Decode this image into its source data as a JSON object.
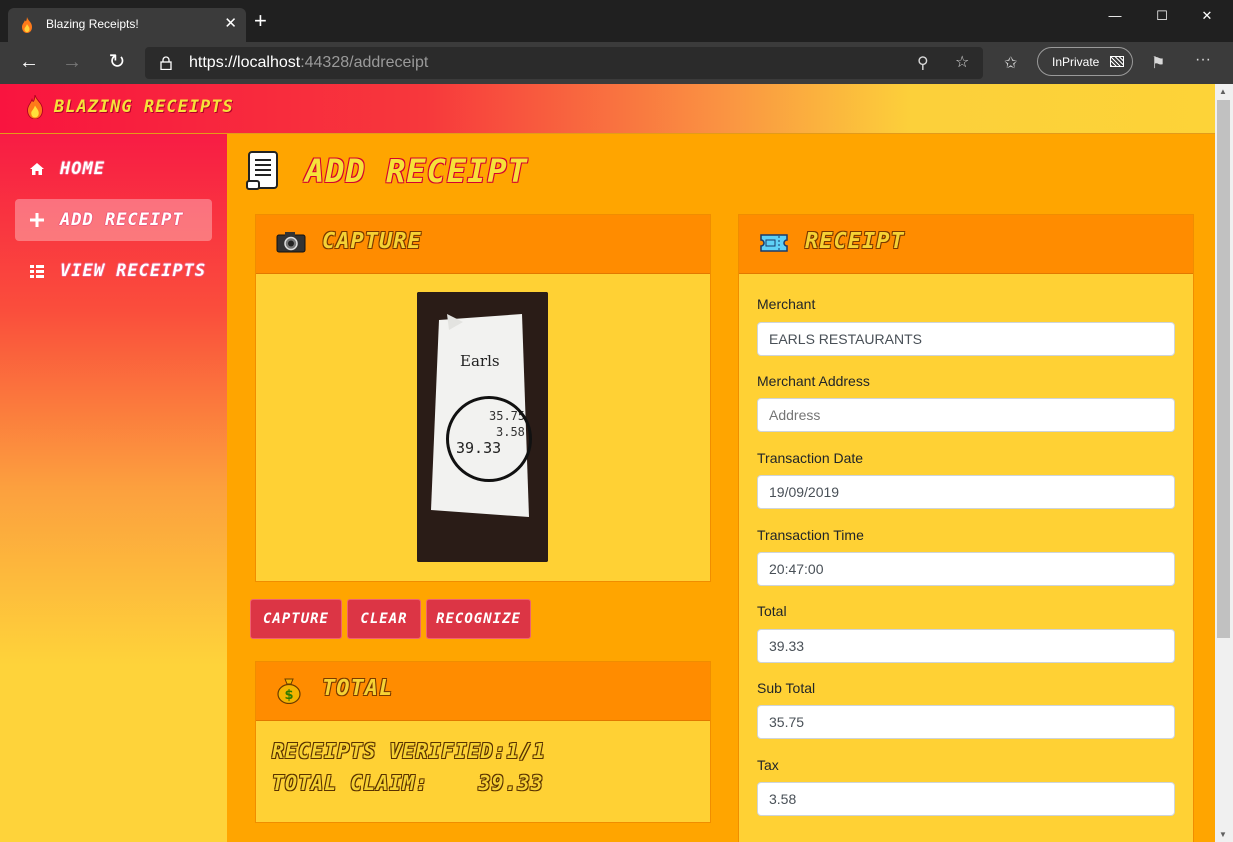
{
  "browser": {
    "tab_title": "Blazing Receipts!",
    "url_scheme": "https://",
    "url_host": "localhost",
    "url_rest": ":44328/addreceipt",
    "inprivate_label": "InPrivate"
  },
  "app": {
    "brand": "BLAZING RECEIPTS"
  },
  "sidebar": {
    "items": [
      {
        "label": "HOME",
        "icon": "home-icon",
        "active": false
      },
      {
        "label": "ADD RECEIPT",
        "icon": "plus-icon",
        "active": true
      },
      {
        "label": "VIEW RECEIPTS",
        "icon": "list-icon",
        "active": false
      }
    ]
  },
  "page": {
    "title": "ADD RECEIPT"
  },
  "capture": {
    "title": "CAPTURE",
    "photo": {
      "header": "Earls",
      "lines": [
        "35.75",
        "3.58",
        "39.33"
      ]
    },
    "buttons": {
      "capture": "CAPTURE",
      "clear": "CLEAR",
      "recognize": "RECOGNIZE"
    }
  },
  "total": {
    "title": "TOTAL",
    "verified_label": "RECEIPTS VERIFIED:",
    "verified_value": "1/1",
    "claim_label": "TOTAL CLAIM:",
    "claim_value": "39.33"
  },
  "receipt": {
    "title": "RECEIPT",
    "fields": [
      {
        "label": "Merchant",
        "value": "EARLS RESTAURANTS",
        "placeholder": ""
      },
      {
        "label": "Merchant Address",
        "value": "",
        "placeholder": "Address"
      },
      {
        "label": "Transaction Date",
        "value": "19/09/2019",
        "placeholder": ""
      },
      {
        "label": "Transaction Time",
        "value": "20:47:00",
        "placeholder": ""
      },
      {
        "label": "Total",
        "value": "39.33",
        "placeholder": ""
      },
      {
        "label": "Sub Total",
        "value": "35.75",
        "placeholder": ""
      },
      {
        "label": "Tax",
        "value": "3.58",
        "placeholder": ""
      }
    ]
  },
  "colors": {
    "page_bg": "#ffa500",
    "card_bg": "#ffd134",
    "card_header": "#ff8c00",
    "button": "#dc3545",
    "brand_red": "#f9143f"
  }
}
